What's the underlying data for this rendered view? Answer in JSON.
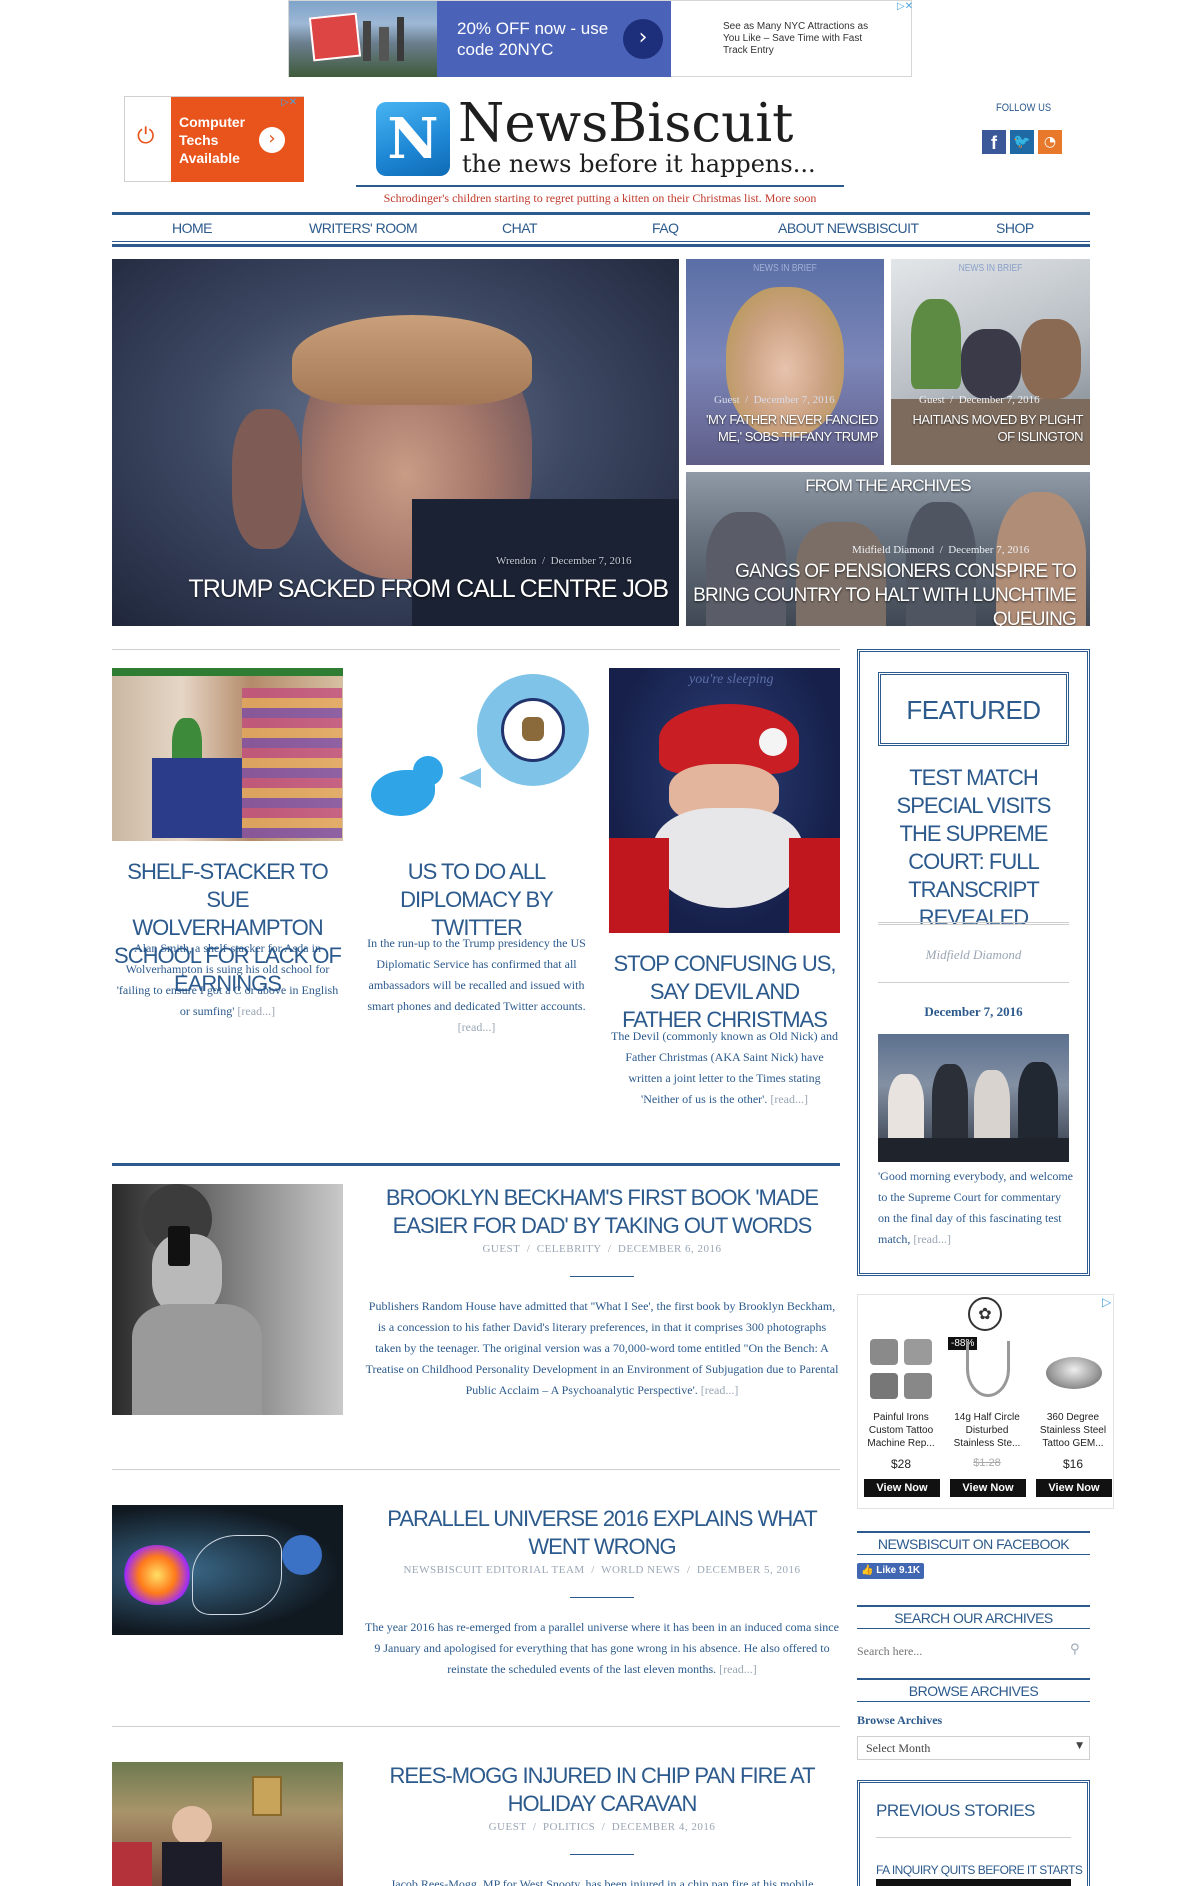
{
  "ad_top": {
    "headline": "20% OFF now - use code 20NYC",
    "side_text": "See as Many NYC Attractions as You Like – Save Time with Fast Track Entry"
  },
  "ad_left": {
    "text": "Computer Techs Available"
  },
  "logo": {
    "letter": "N",
    "name": "NewsBiscuit",
    "tagline": "the news before it happens..."
  },
  "ticker": "Schrodinger's children starting to regret putting a kitten on their Christmas list. More soon",
  "follow_us": "FOLLOW US",
  "nav": [
    "HOME",
    "WRITERS' ROOM",
    "CHAT",
    "FAQ",
    "ABOUT NEWSBISCUIT",
    "SHOP"
  ],
  "hero": {
    "main": {
      "author": "Wrendon",
      "date": "December 7, 2016",
      "title": "TRUMP SACKED FROM CALL CENTRE JOB"
    },
    "tile1": {
      "kicker": "NEWS IN BRIEF",
      "author": "Guest",
      "date": "December 7, 2016",
      "title": "'MY FATHER NEVER FANCIED ME,' SOBS TIFFANY TRUMP"
    },
    "tile2": {
      "kicker": "NEWS IN BRIEF",
      "author": "Guest",
      "date": "December 7, 2016",
      "title": "HAITIANS MOVED BY PLIGHT OF ISLINGTON"
    },
    "tile3": {
      "kicker": "FROM THE ARCHIVES",
      "author": "Midfield Diamond",
      "date": "December 7, 2016",
      "title": "GANGS OF PENSIONERS CONSPIRE TO BRING COUNTRY TO HALT WITH LUNCHTIME QUEUING"
    }
  },
  "cards": [
    {
      "title": "SHELF-STACKER TO SUE WOLVERHAMPTON SCHOOL FOR LACK OF EARNINGS",
      "body": "Alan Smith, a shelf-stacker for Asda in Wolverhampton is suing his old school for 'failing to ensure I got a C or above in English or sumfing'",
      "read": "[read...]"
    },
    {
      "title": "US TO DO ALL DIPLOMACY BY TWITTER",
      "body": "In the run-up to the Trump presidency the US Diplomatic Service has confirmed that all ambassadors will be recalled and issued with smart phones and dedicated Twitter accounts.",
      "read": "[read...]"
    },
    {
      "title": "STOP CONFUSING US, SAY DEVIL AND FATHER CHRISTMAS",
      "body": "The Devil (commonly known as Old Nick) and Father Christmas (AKA Saint Nick) have written a joint letter to the Times stating 'Neither of us is the other'.",
      "read": "[read...]",
      "img_text": "you're sleeping"
    }
  ],
  "articles": [
    {
      "title": "BROOKLYN BECKHAM'S FIRST BOOK 'MADE EASIER FOR DAD' BY TAKING OUT WORDS",
      "author": "GUEST",
      "category": "CELEBRITY",
      "date": "DECEMBER 6, 2016",
      "body": "Publishers Random House have admitted that ''What I See', the first book by Brooklyn Beckham, is a concession to his father David's literary preferences, in that it comprises 300 photographs taken by the teenager. The original version was a 70,000-word tome entitled \"On the Bench: A Treatise on Childhood Personality Development in an Environment of Subjugation due to Parental Public Acclaim – A Psychoanalytic Perspective'.",
      "read": "[read...]"
    },
    {
      "title": "PARALLEL UNIVERSE 2016 EXPLAINS WHAT WENT WRONG",
      "author": "NEWSBISCUIT EDITORIAL TEAM",
      "category": "WORLD NEWS",
      "date": "DECEMBER 5, 2016",
      "body": "The year 2016 has re-emerged from a parallel universe where it has been in an induced coma since 9 January and apologised for everything that has gone wrong in his absence. He also offered to reinstate the scheduled events of the last eleven months.",
      "read": "[read...]"
    },
    {
      "title": "REES-MOGG INJURED IN CHIP PAN FIRE AT HOLIDAY CARAVAN",
      "author": "GUEST",
      "category": "POLITICS",
      "date": "DECEMBER 4, 2016",
      "body": "Jacob Rees-Mogg, MP for West Snooty, has been injured in a chip pan fire at his mobile"
    }
  ],
  "featured": {
    "label": "FEATURED",
    "title": "TEST MATCH SPECIAL VISITS THE SUPREME COURT: FULL TRANSCRIPT REVEALED",
    "author": "Midfield Diamond",
    "date": "December 7, 2016",
    "body": "'Good morning everybody, and welcome to the Supreme Court for commentary on the final day of this fascinating test match,",
    "read": "[read...]"
  },
  "shop_ad": {
    "badge": "-88%",
    "products": [
      {
        "name": "Painful Irons Custom Tattoo Machine Rep...",
        "price": "$28",
        "old_price": "",
        "button": "View Now"
      },
      {
        "name": "14g Half Circle Disturbed Stainless Ste...",
        "price": "$1.28",
        "old_price": "$1.28",
        "button": "View Now"
      },
      {
        "name": "360 Degree Stainless Steel Tattoo GEM...",
        "price": "$16",
        "old_price": "",
        "button": "View Now"
      }
    ]
  },
  "sidebar": {
    "facebook_head": "NEWSBISCUIT ON FACEBOOK",
    "like_label": "Like 9.1K",
    "search_head": "SEARCH OUR ARCHIVES",
    "search_placeholder": "Search here...",
    "browse_head": "BROWSE ARCHIVES",
    "browse_label": "Browse Archives",
    "select_value": "Select Month",
    "previous_head": "PREVIOUS STORIES",
    "previous_item": "FA INQUIRY QUITS BEFORE IT STARTS"
  },
  "colors": {
    "brand": "#2c5a8c",
    "accent_red": "#c0392b",
    "ad_orange": "#e8541b"
  }
}
